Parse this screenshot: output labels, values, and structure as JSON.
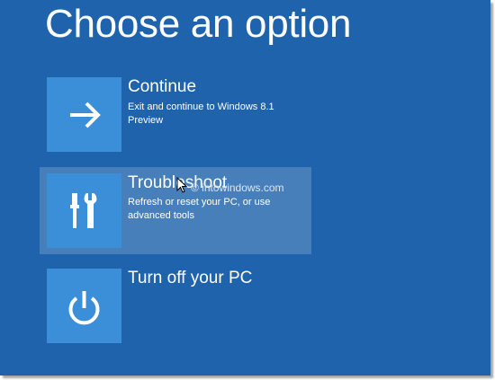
{
  "page": {
    "title": "Choose an option"
  },
  "options": [
    {
      "title": "Continue",
      "description": "Exit and continue to Windows 8.1 Preview",
      "icon": "arrow-right-icon"
    },
    {
      "title": "Troubleshoot",
      "description": "Refresh or reset your PC, or use advanced tools",
      "icon": "tools-icon"
    },
    {
      "title": "Turn off your PC",
      "description": "",
      "icon": "power-icon"
    }
  ],
  "watermark": {
    "text": "© intowindows.com"
  },
  "colors": {
    "background": "#1f63ad",
    "tile": "#3b8fd9",
    "highlight": "rgba(255,255,255,0.18)"
  }
}
